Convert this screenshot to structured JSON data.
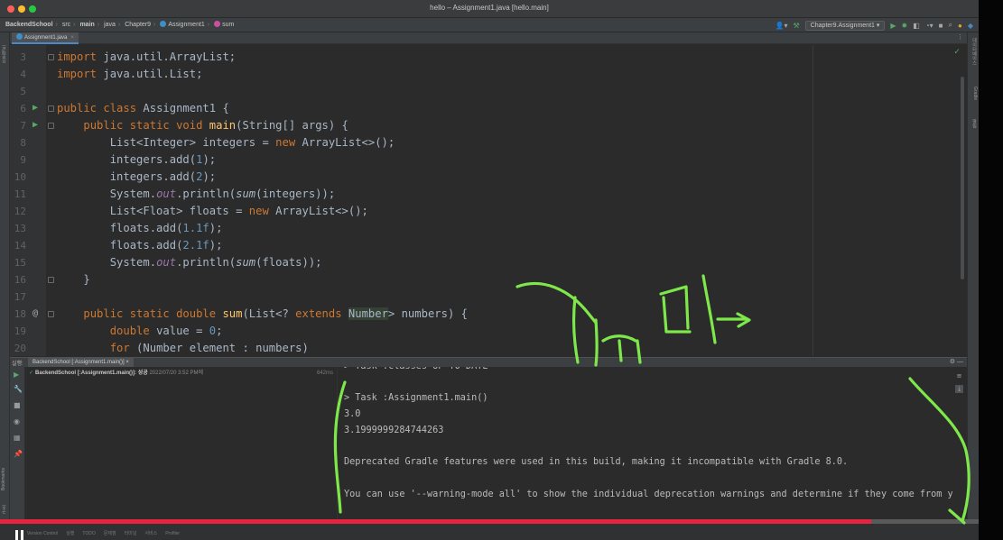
{
  "window": {
    "title": "hello – Assignment1.java [hello.main]"
  },
  "breadcrumb": [
    "BackendSchool",
    "src",
    "main",
    "java",
    "Chapter9",
    "Assignment1",
    "sum"
  ],
  "toolbar": {
    "run_config": "Chapter9.Assignment1"
  },
  "editor": {
    "tab": "Assignment1.java",
    "lines": [
      {
        "n": "3",
        "tokens": [
          [
            "kw",
            "import"
          ],
          [
            "",
            " java.util.ArrayList;"
          ]
        ]
      },
      {
        "n": "4",
        "tokens": [
          [
            "kw",
            "import"
          ],
          [
            "",
            " java.util.List;"
          ]
        ]
      },
      {
        "n": "5",
        "tokens": []
      },
      {
        "n": "6",
        "marker": "run",
        "tokens": [
          [
            "kw",
            "public class"
          ],
          [
            "",
            " Assignment1 {"
          ]
        ]
      },
      {
        "n": "7",
        "marker": "run",
        "tokens": [
          [
            "",
            "    "
          ],
          [
            "kw",
            "public static void"
          ],
          [
            "",
            " "
          ],
          [
            "fn",
            "main"
          ],
          [
            "",
            "(String[] args) {"
          ]
        ]
      },
      {
        "n": "8",
        "tokens": [
          [
            "",
            "        List<Integer> integers = "
          ],
          [
            "kw",
            "new"
          ],
          [
            "",
            " ArrayList<>();"
          ]
        ]
      },
      {
        "n": "9",
        "tokens": [
          [
            "",
            "        integers.add("
          ],
          [
            "num",
            "1"
          ],
          [
            "",
            ");"
          ]
        ]
      },
      {
        "n": "10",
        "tokens": [
          [
            "",
            "        integers.add("
          ],
          [
            "num",
            "2"
          ],
          [
            "",
            ");"
          ]
        ]
      },
      {
        "n": "11",
        "tokens": [
          [
            "",
            "        System."
          ],
          [
            "fld",
            "out"
          ],
          [
            "",
            ".println("
          ],
          [
            "it",
            "sum"
          ],
          [
            "",
            "(integers));"
          ]
        ]
      },
      {
        "n": "12",
        "tokens": [
          [
            "",
            "        List<Float> floats = "
          ],
          [
            "kw",
            "new"
          ],
          [
            "",
            " ArrayList<>();"
          ]
        ]
      },
      {
        "n": "13",
        "tokens": [
          [
            "",
            "        floats.add("
          ],
          [
            "num",
            "1.1f"
          ],
          [
            "",
            ");"
          ]
        ]
      },
      {
        "n": "14",
        "tokens": [
          [
            "",
            "        floats.add("
          ],
          [
            "num",
            "2.1f"
          ],
          [
            "",
            ");"
          ]
        ]
      },
      {
        "n": "15",
        "tokens": [
          [
            "",
            "        System."
          ],
          [
            "fld",
            "out"
          ],
          [
            "",
            ".println("
          ],
          [
            "it",
            "sum"
          ],
          [
            "",
            "(floats));"
          ]
        ]
      },
      {
        "n": "16",
        "tokens": [
          [
            "",
            "    }"
          ]
        ]
      },
      {
        "n": "17",
        "tokens": []
      },
      {
        "n": "18",
        "marker": "at",
        "tokens": [
          [
            "",
            "    "
          ],
          [
            "kw",
            "public static double"
          ],
          [
            "",
            " "
          ],
          [
            "fn",
            "sum"
          ],
          [
            "",
            "(List<? "
          ],
          [
            "kw",
            "extends"
          ],
          [
            "",
            " "
          ],
          [
            "hl",
            "Number"
          ],
          [
            "",
            "> numbers) {"
          ]
        ]
      },
      {
        "n": "19",
        "tokens": [
          [
            "",
            "        "
          ],
          [
            "kw",
            "double"
          ],
          [
            "",
            " value = "
          ],
          [
            "num",
            "0"
          ],
          [
            "",
            ";"
          ]
        ]
      },
      {
        "n": "20",
        "tokens": [
          [
            "",
            "        "
          ],
          [
            "kw",
            "for"
          ],
          [
            "",
            " (Number element : numbers)"
          ]
        ]
      }
    ]
  },
  "run": {
    "title": "실행:",
    "tab": "BackendSchool [:Assignment1.main()]",
    "tree_item": {
      "name": "BackendSchool [:Assignment1.main()]:",
      "result": "성공",
      "timestamp": "2022/07/20 3:52 PM에",
      "duration": "642ms"
    },
    "console": [
      "> Task :classes UP-TO-DATE",
      "",
      "> Task :Assignment1.main()",
      "3.0",
      "3.1999999284744263",
      "",
      "Deprecated Gradle features were used in this build, making it incompatible with Gradle 8.0.",
      "",
      "You can use '--warning-mode all' to show the individual deprecation warnings and determine if they come from you"
    ]
  },
  "left_strip": [
    "프로젝트",
    "Bookmarks",
    "구조"
  ],
  "right_strip": [
    "데이터베이스",
    "Gradle",
    "알림"
  ],
  "status_bar": [
    "Version Control",
    "실행",
    "TODO",
    "문제점",
    "터미널",
    "서비스",
    "Profiler"
  ],
  "video": {
    "progress": 0.89
  },
  "colors": {
    "accent": "#4a88c7",
    "run_green": "#59a869",
    "scribble": "#7ee84a",
    "progress": "#e8233f"
  }
}
